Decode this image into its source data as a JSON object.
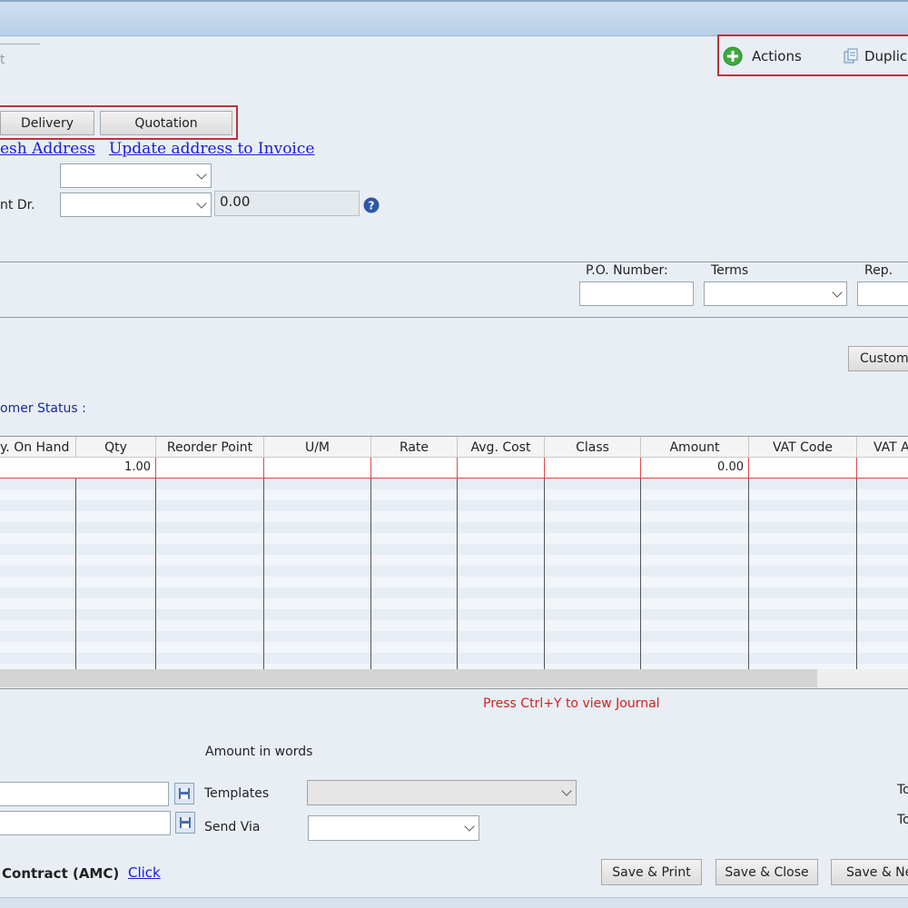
{
  "toolbar": {
    "actions_label": "Actions",
    "duplicate_label": "Duplica",
    "tab_fragment": "t"
  },
  "convert_buttons": {
    "delivery": "Delivery",
    "quotation": "Quotation"
  },
  "address_links": {
    "refresh": "esh Address",
    "update": "Update address to Invoice"
  },
  "header_fields": {
    "account_dr_label": "nt Dr.",
    "amount_value": "0.00"
  },
  "order_fields": {
    "po_number_label": "P.O. Number:",
    "terms_label": "Terms",
    "rep_label": "Rep."
  },
  "custom_button": "Custom F",
  "customer_status_label": "omer Status :",
  "grid": {
    "columns": [
      "y. On Hand",
      "Qty",
      "Reorder Point",
      "U/M",
      "Rate",
      "Avg. Cost",
      "Class",
      "Amount",
      "VAT Code",
      "VAT A"
    ],
    "first_row": {
      "qty": "1.00",
      "amount": "0.00"
    }
  },
  "journal_hint": "Press Ctrl+Y to view Journal",
  "footer": {
    "amount_in_words_label": "Amount in words",
    "templates_label": "Templates",
    "send_via_label": "Send Via",
    "to_label_1": "To",
    "to_label_2": "To",
    "amc_label": "Contract (AMC)",
    "amc_link": "Click",
    "save_print": "Save & Print",
    "save_close": "Save & Close",
    "save_new": "Save & Ne"
  },
  "colors": {
    "highlight_border": "#b8353a",
    "link": "#1a1adc",
    "journal_hint": "#d42020",
    "status_label": "#1a2a9a"
  },
  "icons": {
    "actions": "plus-circle-icon",
    "duplicate": "copy-document-icon",
    "help": "question-circle-icon",
    "save": "floppy-disk-icon"
  }
}
